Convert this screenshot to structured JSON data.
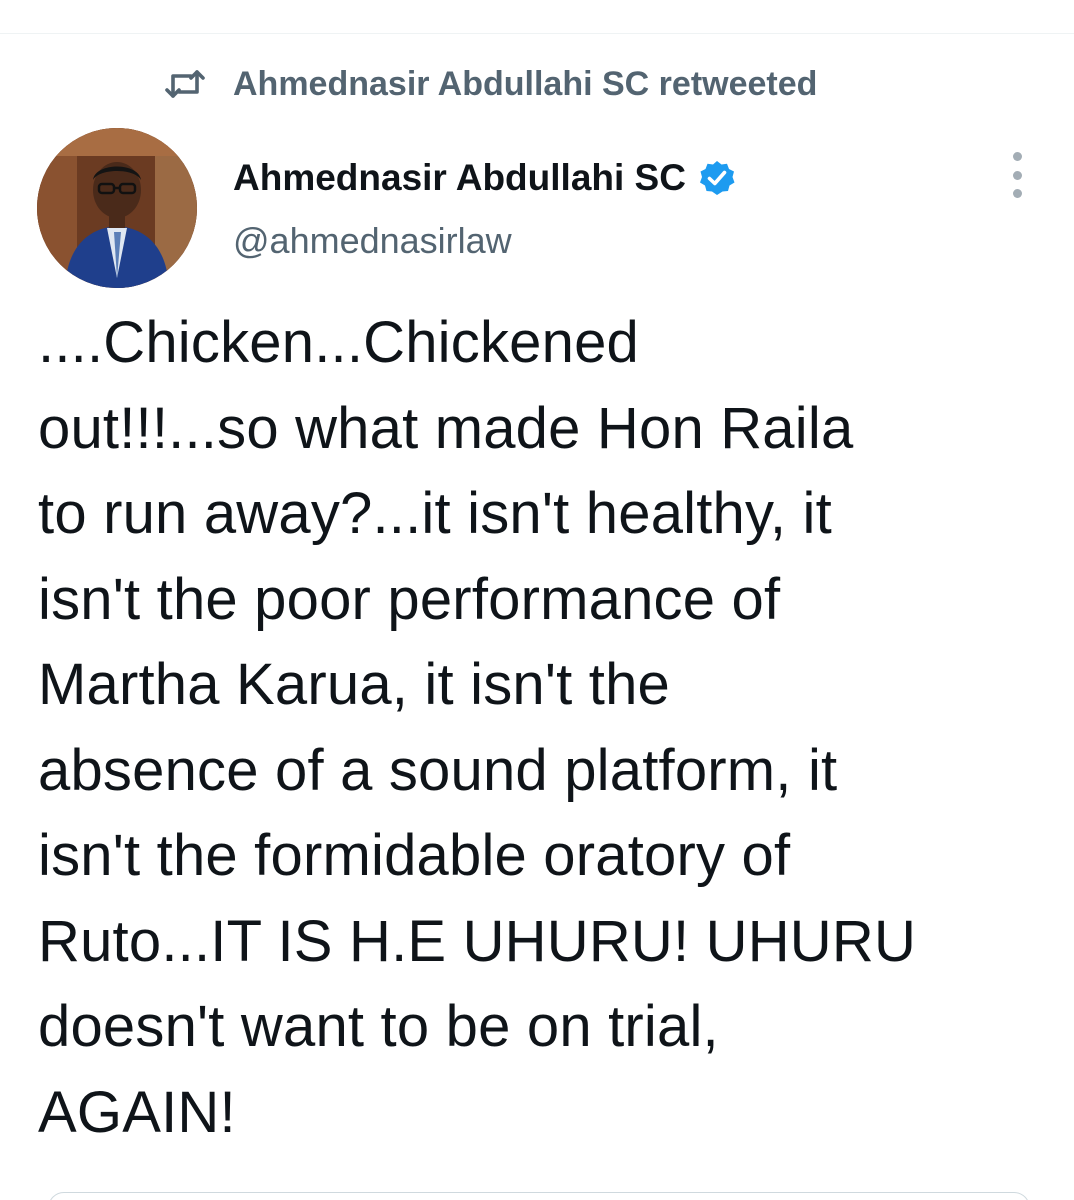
{
  "colors": {
    "text_primary": "#0f1419",
    "text_secondary": "#536471",
    "verified": "#1d9bf0",
    "divider": "#eff3f4"
  },
  "retweet": {
    "icon": "retweet-icon",
    "text": "Ahmednasir Abdullahi SC retweeted"
  },
  "author": {
    "name": "Ahmednasir Abdullahi SC",
    "handle": "@ahmednasirlaw",
    "verified_icon": "verified-badge-icon",
    "avatar": "profile-photo"
  },
  "menu": {
    "icon": "more-vertical-icon"
  },
  "tweet": {
    "lines": [
      "....Chicken...Chickened",
      "out!!!...so what made Hon Raila",
      "to run away?...it isn't healthy, it",
      "isn't the poor performance of",
      "Martha Karua, it isn't the",
      "absence of a sound platform, it",
      "isn't the formidable oratory of",
      "Ruto...IT IS H.E UHURU! UHURU",
      "doesn't want to be on trial,",
      "AGAIN!"
    ]
  }
}
